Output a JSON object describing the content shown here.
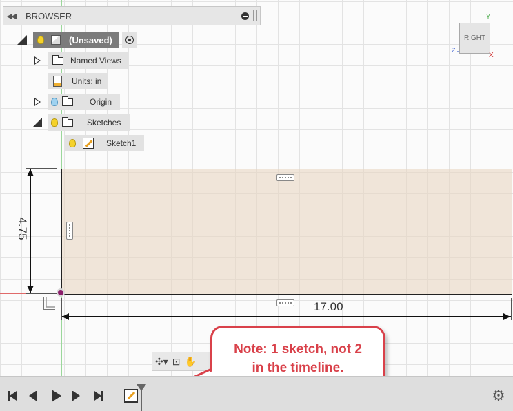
{
  "browser": {
    "title": "BROWSER",
    "root": {
      "label": "(Unsaved)"
    },
    "items": [
      {
        "label": "Named Views"
      },
      {
        "label": "Units: in"
      },
      {
        "label": "Origin"
      },
      {
        "label": "Sketches"
      },
      {
        "label": "Sketch1"
      }
    ]
  },
  "viewcube": {
    "face": "RIGHT",
    "axis_y": "Y",
    "axis_z": "Z",
    "axis_x": "X"
  },
  "sketch": {
    "dimension_vertical": "4.75",
    "dimension_horizontal": "17.00"
  },
  "callout": {
    "line1": "Note: 1 sketch, not 2",
    "line2": "in the timeline."
  },
  "colors": {
    "callout_accent": "#d9414a",
    "sketch_fill": "#e8d6c4",
    "origin_point": "#8b1e6a",
    "axis_x": "#e06a6a",
    "axis_y": "#9bd79b"
  },
  "timeline": {
    "buttons": [
      "go-to-start",
      "previous-step",
      "play",
      "next-step",
      "go-to-end"
    ],
    "features": [
      "sketch"
    ]
  }
}
